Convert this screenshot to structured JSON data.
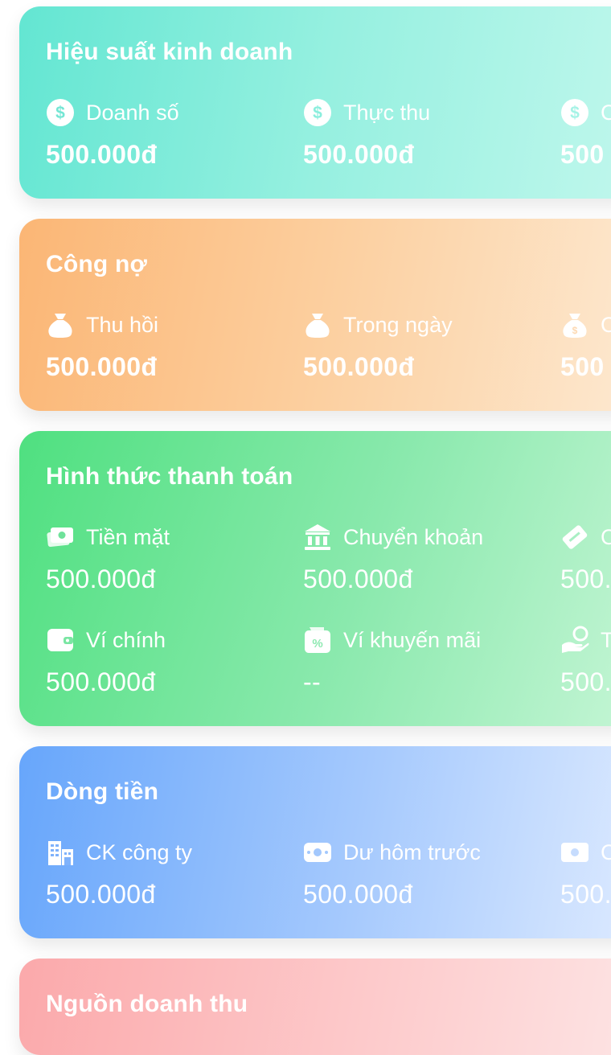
{
  "business": {
    "title": "Hiệu suất kinh doanh",
    "metrics": [
      {
        "label": "Doanh số",
        "value": "500.000đ",
        "icon": "dollar-circle-icon"
      },
      {
        "label": "Thực thu",
        "value": "500.000đ",
        "icon": "dollar-circle-icon"
      },
      {
        "label": "C",
        "value": "500",
        "icon": "dollar-circle-icon"
      }
    ]
  },
  "debt": {
    "title": "Công nợ",
    "metrics": [
      {
        "label": "Thu hồi",
        "value": "500.000đ",
        "icon": "money-bag-icon"
      },
      {
        "label": "Trong ngày",
        "value": "500.000đ",
        "icon": "money-bag-icon"
      },
      {
        "label": "C",
        "value": "500",
        "icon": "money-bag-dollar-icon"
      }
    ]
  },
  "payment": {
    "title": "Hình thức thanh toán",
    "metrics": [
      {
        "label": "Tiền mặt",
        "value": "500.000đ",
        "icon": "cash-icon"
      },
      {
        "label": "Chuyển khoản",
        "value": "500.000đ",
        "icon": "bank-icon"
      },
      {
        "label": "C",
        "value": "500.",
        "icon": "card-icon"
      },
      {
        "label": "Ví chính",
        "value": "500.000đ",
        "icon": "wallet-icon"
      },
      {
        "label": "Ví khuyến mãi",
        "value": "--",
        "icon": "promo-wallet-icon"
      },
      {
        "label": "T",
        "value": "500.",
        "icon": "hand-coin-icon"
      }
    ]
  },
  "cashflow": {
    "title": "Dòng tiền",
    "metrics": [
      {
        "label": "CK công ty",
        "value": "500.000đ",
        "icon": "company-icon"
      },
      {
        "label": "Dư hôm trước",
        "value": "500.000đ",
        "icon": "banknote-icon"
      },
      {
        "label": "C",
        "value": "500.",
        "icon": "banknote-icon"
      }
    ]
  },
  "revenue_source": {
    "title": "Nguồn doanh thu"
  },
  "colors": {
    "business": "#63e6d2",
    "debt": "#fbb675",
    "payment": "#4fe080",
    "cashflow": "#67a6fb",
    "revenue_source": "#fba9ab"
  }
}
